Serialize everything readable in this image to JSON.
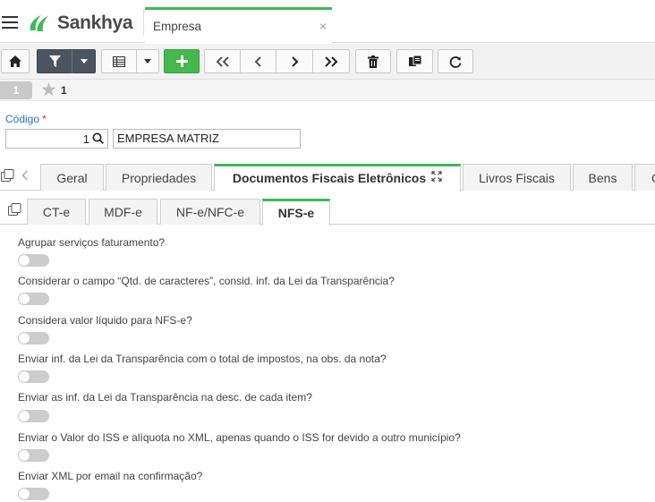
{
  "header": {
    "brand": "Sankhya",
    "tab_label": "Empresa",
    "close_glyph": "×"
  },
  "toolbar": {
    "buttons": [
      "home-icon",
      "filter-icon",
      "dropdown-icon",
      "grid-icon",
      "dropdown-icon",
      "add-icon",
      "first-record-icon",
      "previous-record-icon",
      "next-record-icon",
      "last-record-icon",
      "delete-icon",
      "copy-record-icon",
      "refresh-icon"
    ]
  },
  "record": {
    "number": "1",
    "favorites_count": "1"
  },
  "form": {
    "codigo_label": "Código",
    "required_mark": "*",
    "codigo_value": "1",
    "empresa_value": "EMPRESA MATRIZ"
  },
  "main_tabs": [
    {
      "label": "Geral"
    },
    {
      "label": "Propriedades"
    },
    {
      "label": "Documentos Fiscais Eletrônicos"
    },
    {
      "label": "Livros Fiscais"
    },
    {
      "label": "Bens"
    },
    {
      "label": "C"
    }
  ],
  "sub_tabs": [
    {
      "label": "CT-e"
    },
    {
      "label": "MDF-e"
    },
    {
      "label": "NF-e/NFC-e"
    },
    {
      "label": "NFS-e"
    }
  ],
  "options": [
    {
      "label": "Agrupar serviços faturamento?",
      "enabled": false
    },
    {
      "label": "Considerar o campo “Qtd. de caracteres”, consid. inf. da Lei da Transparência?",
      "enabled": false
    },
    {
      "label": "Considera valor líquido para NFS-e?",
      "enabled": false
    },
    {
      "label": "Enviar inf. da Lei da Transparência com o total de impostos, na obs. da nota?",
      "enabled": false
    },
    {
      "label": "Enviar as inf. da Lei da Transparência na desc. de cada item?",
      "enabled": false
    },
    {
      "label": "Enviar o Valor do ISS e alíquota no XML, apenas quando o ISS for devido a outro município?",
      "enabled": false
    },
    {
      "label": "Enviar XML por email na confirmação?",
      "enabled": false
    }
  ],
  "colors": {
    "accent_green": "#3fb85a",
    "add_button_green": "#43b94b",
    "filter_button_dark": "#4b5562",
    "label_blue": "#2c6ed5",
    "required_red": "#d9342b",
    "toggle_off": "#cdcdcd"
  }
}
